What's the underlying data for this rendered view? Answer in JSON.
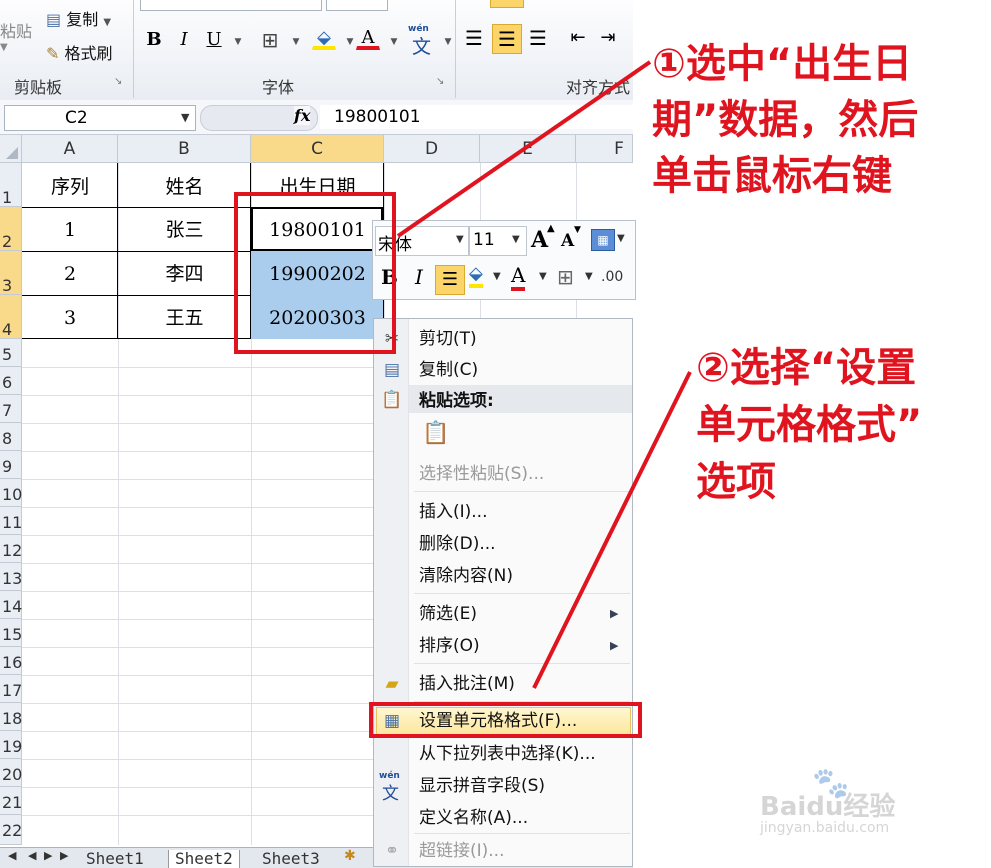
{
  "ribbon": {
    "paste_label": "粘贴",
    "copy_label": "复制",
    "format_painter_label": "格式刷",
    "clipboard_group": "剪贴板",
    "font_group": "字体",
    "alignment_group": "对齐方式",
    "bold": "B",
    "italic": "I",
    "underline": "U",
    "font_color_letter": "A",
    "wen_label": "wén",
    "wen_char": "文"
  },
  "formula_bar": {
    "name_box": "C2",
    "fx": "fx",
    "value": "19800101"
  },
  "sheet": {
    "columns": [
      "A",
      "B",
      "C",
      "D",
      "E",
      "F"
    ],
    "rows": [
      "1",
      "2",
      "3",
      "4",
      "5",
      "6",
      "7",
      "8",
      "9",
      "10",
      "11",
      "12",
      "13",
      "14",
      "15",
      "16",
      "17",
      "18",
      "19",
      "20",
      "21",
      "22"
    ],
    "headers": [
      "序列",
      "姓名",
      "出生日期"
    ],
    "data": [
      [
        "1",
        "张三",
        "19800101"
      ],
      [
        "2",
        "李四",
        "19900202"
      ],
      [
        "3",
        "王五",
        "20200303"
      ]
    ]
  },
  "tabs": [
    "Sheet1",
    "Sheet2",
    "Sheet3"
  ],
  "mini_toolbar": {
    "font_name": "宋体",
    "font_size": "11",
    "grow": "A",
    "shrink": "A",
    "bold": "B",
    "italic": "I",
    "font_color_letter": "A",
    "number_format": ".00"
  },
  "context_menu": {
    "cut": "剪切(T)",
    "copy": "复制(C)",
    "paste_options": "粘贴选项:",
    "paste_special": "选择性粘贴(S)...",
    "insert": "插入(I)...",
    "delete": "删除(D)...",
    "clear": "清除内容(N)",
    "filter": "筛选(E)",
    "sort": "排序(O)",
    "insert_comment": "插入批注(M)",
    "format_cells": "设置单元格格式(F)...",
    "pick_list": "从下拉列表中选择(K)...",
    "phonetic": "显示拼音字段(S)",
    "define_name": "定义名称(A)...",
    "hyperlink": "超链接(I)..."
  },
  "annotations": {
    "step1": "①选中“出生日期”数据，然后单击鼠标右键",
    "step1_line1": "①选中“出生日",
    "step1_line2": "期”数据，然后",
    "step1_line3": "单击鼠标右键",
    "step2_line1": "②选择“设置",
    "step2_line2": "单元格格式”",
    "step2_line3": "选项"
  },
  "watermark": {
    "brand": "Baidu经验",
    "url": "jingyan.baidu.com"
  },
  "colors": {
    "accent_red": "#e0141f",
    "selection": "#aacdee",
    "header_selected": "#f9d98a"
  }
}
